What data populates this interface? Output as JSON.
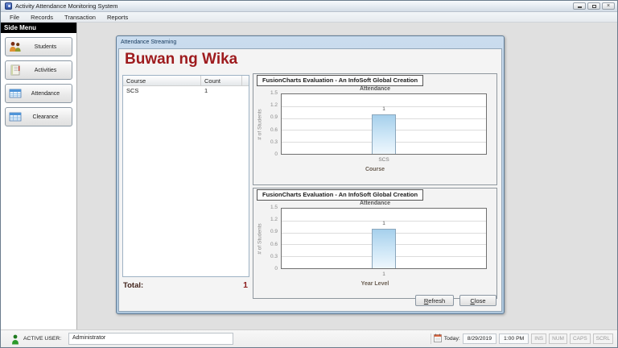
{
  "window": {
    "title": "Activity Attendance Monitoring System"
  },
  "menu": {
    "items": [
      {
        "label": "File"
      },
      {
        "label": "Records"
      },
      {
        "label": "Transaction"
      },
      {
        "label": "Reports"
      }
    ]
  },
  "sidebar": {
    "header": "Side Menu",
    "items": [
      {
        "label": "Students"
      },
      {
        "label": "Activities"
      },
      {
        "label": "Attendance"
      },
      {
        "label": "Clearance"
      }
    ]
  },
  "child_window": {
    "title": "Attendance Streaming",
    "heading": "Buwan ng Wika",
    "table": {
      "columns": [
        "Course",
        "Count"
      ],
      "rows": [
        [
          "SCS",
          "1"
        ]
      ]
    },
    "total_label": "Total:",
    "total_value": "1",
    "buttons": {
      "refresh_accel": "R",
      "refresh_rest": "efresh",
      "close_accel": "C",
      "close_rest": "lose"
    }
  },
  "charts_header": "FusionCharts Evaluation - An InfoSoft Global Creation",
  "chart_data": [
    {
      "type": "bar",
      "title": "Attendance",
      "categories": [
        "SCS"
      ],
      "values": [
        1
      ],
      "data_labels": [
        "1"
      ],
      "xlabel": "Course",
      "ylabel": "# of Students",
      "ylim": [
        0,
        1.5
      ],
      "yticks": [
        0,
        0.3,
        0.6,
        0.9,
        1.2,
        1.5
      ],
      "ytick_labels_desc": [
        "1.5",
        "1.2",
        "0.9",
        "0.6",
        "0.3",
        "0"
      ],
      "grid": true,
      "legend": false,
      "bar_color": "#a6d0ec"
    },
    {
      "type": "bar",
      "title": "Attendance",
      "categories": [
        "1"
      ],
      "values": [
        1
      ],
      "data_labels": [
        "1"
      ],
      "xlabel": "Year Level",
      "ylabel": "# of Students",
      "ylim": [
        0,
        1.5
      ],
      "yticks": [
        0,
        0.3,
        0.6,
        0.9,
        1.2,
        1.5
      ],
      "ytick_labels_desc": [
        "1.5",
        "1.2",
        "0.9",
        "0.6",
        "0.3",
        "0"
      ],
      "grid": true,
      "legend": false,
      "bar_color": "#a6d0ec"
    }
  ],
  "status_bar": {
    "active_user_label": "ACTIVE USER:",
    "active_user_value": "Administrator",
    "today_label": "Today:",
    "date": "8/29/2019",
    "time": "1:00 PM",
    "flags": [
      "INS",
      "NUM",
      "CAPS",
      "SCRL"
    ]
  },
  "icons": {
    "close_glyph": "×",
    "app": "blue-app-logo",
    "minimize": "minimize-bar",
    "restore": "restore-square",
    "students": "two-people",
    "activities": "notepad",
    "attendance": "blue-table-grid",
    "clearance": "blue-table-grid",
    "active_user": "green-person",
    "calendar": "calendar"
  },
  "colors": {
    "heading": "#9e1b1e",
    "total_value": "#8c1c1c",
    "bar_fill_top": "#a6d0ec",
    "bar_fill_bottom": "#eef7fd",
    "child_titlebar": "#bcd2e8",
    "sidebar_header_bg": "#000000",
    "status_flag_text": "#9a9a9a"
  }
}
